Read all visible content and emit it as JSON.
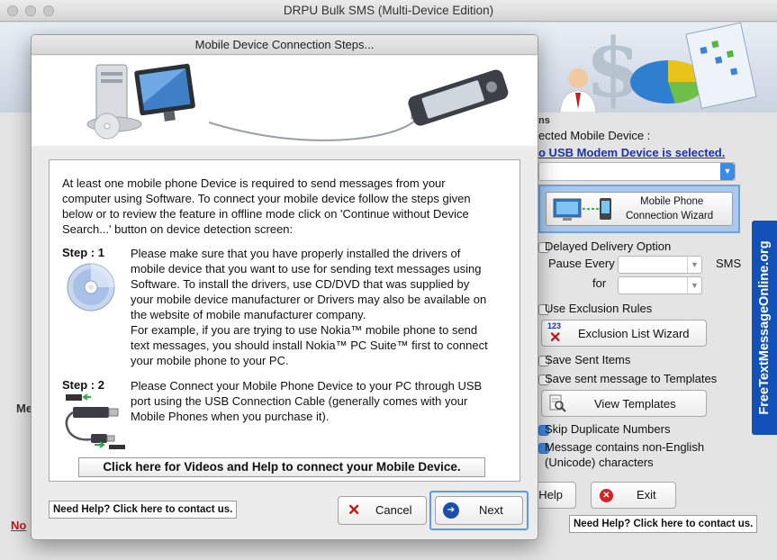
{
  "window": {
    "title": "DRPU Bulk SMS (Multi-Device Edition)"
  },
  "main": {
    "section_fragment": "ns",
    "selected_device_label": "ected Mobile Device :",
    "selected_device_link": "o USB Modem Device is selected.",
    "wizard_line1": "Mobile Phone",
    "wizard_line2": "Connection  Wizard",
    "delayed_delivery": "Delayed Delivery Option",
    "pause_every": "Pause Every",
    "sms": "SMS",
    "for": "for",
    "use_exclusion": "Use Exclusion Rules",
    "exclusion_wizard": "Exclusion List Wizard",
    "exclusion_icon_digits": "123",
    "save_sent": "Save Sent Items",
    "save_templates": "Save sent message to Templates",
    "view_templates": "View Templates",
    "skip_duplicates": "Skip Duplicate Numbers",
    "non_english_1": "Message contains non-English",
    "non_english_2": "(Unicode) characters",
    "help_fragment": "Help",
    "exit": "Exit",
    "contact": "Need Help? Click here to contact us.",
    "left_fragment_me": "Me",
    "left_fragment_no": "No",
    "side_tab": "FreeTextMessageOnline.org"
  },
  "dialog": {
    "title": "Mobile Device Connection Steps...",
    "intro_1": "At least one mobile phone Device is required to send messages from your",
    "intro_2": "computer using Software.  To connect your mobile device follow the steps given",
    "intro_3": "below or to review the feature in offline mode click on 'Continue without Device",
    "intro_4": "Search...' button on device detection screen:",
    "step1_label": "Step : 1",
    "step1_1": "Please make sure that you have properly installed the drivers of",
    "step1_2": "mobile device that you want to use for sending text messages using",
    "step1_3": "Software. To install the drivers, use CD/DVD that was supplied by",
    "step1_4": "your mobile device manufacturer or Drivers may also be available on",
    "step1_5": "the website of mobile manufacturer company.",
    "step1_6": "For example, if you are trying to use Nokia™ mobile phone to send",
    "step1_7": "text messages, you should install Nokia™ PC Suite™ first to connect",
    "step1_8": "your mobile phone to your PC.",
    "step2_label": "Step : 2",
    "step2_1": "Please Connect your Mobile Phone Device to your PC through USB",
    "step2_2": "port using the USB Connection Cable (generally comes with your",
    "step2_3": "Mobile Phones when you purchase it).",
    "help_videos": "Click here for Videos and Help to connect your Mobile Device.",
    "contact": "Need Help? Click here to contact us.",
    "cancel": "Cancel",
    "next": "Next"
  },
  "colors": {
    "accent": "#3d8be8",
    "brand_tab": "#1252b8",
    "link": "#1a2fb5",
    "error": "#cc1111"
  }
}
